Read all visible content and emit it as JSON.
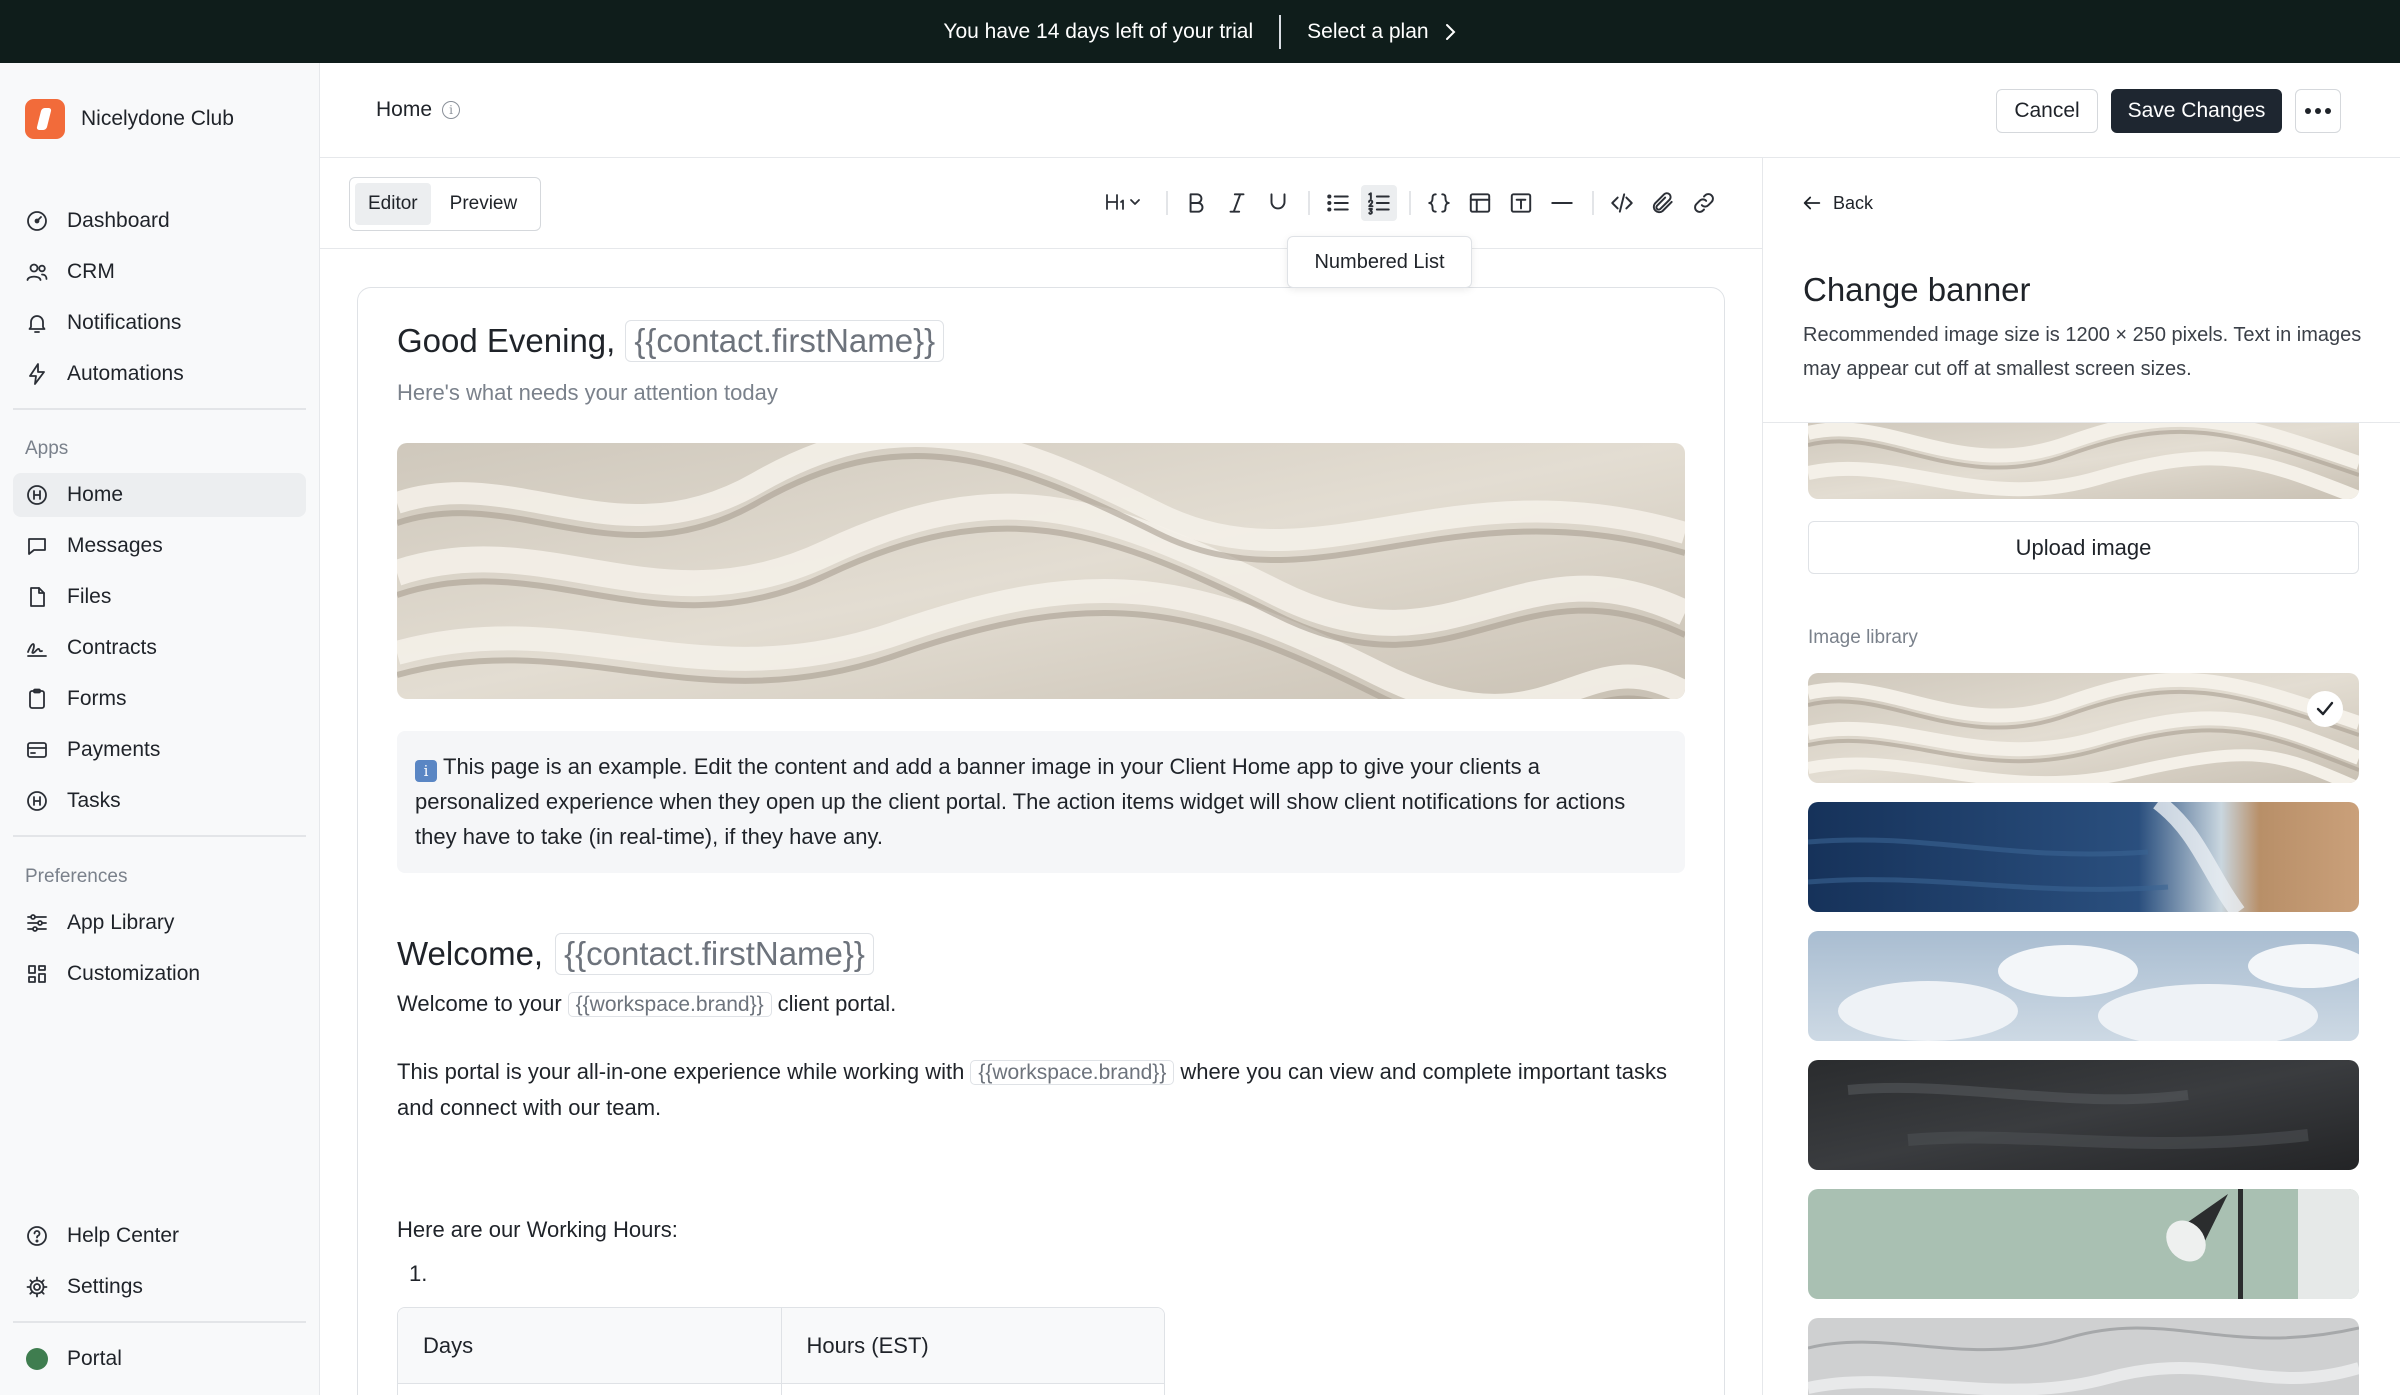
{
  "trial": {
    "message": "You have 14 days left of your trial",
    "cta": "Select a plan"
  },
  "brand": {
    "name": "Nicelydone Club",
    "accent": "#f26b3a"
  },
  "sidebar": {
    "main": [
      {
        "label": "Dashboard",
        "icon": "dashboard-icon"
      },
      {
        "label": "CRM",
        "icon": "users-icon"
      },
      {
        "label": "Notifications",
        "icon": "bell-icon"
      },
      {
        "label": "Automations",
        "icon": "bolt-icon"
      }
    ],
    "apps_title": "Apps",
    "apps": [
      {
        "label": "Home",
        "icon": "home-icon",
        "active": true
      },
      {
        "label": "Messages",
        "icon": "message-icon"
      },
      {
        "label": "Files",
        "icon": "file-icon"
      },
      {
        "label": "Contracts",
        "icon": "signature-icon"
      },
      {
        "label": "Forms",
        "icon": "clipboard-icon"
      },
      {
        "label": "Payments",
        "icon": "card-icon"
      },
      {
        "label": "Tasks",
        "icon": "tasks-icon"
      }
    ],
    "prefs_title": "Preferences",
    "prefs": [
      {
        "label": "App Library",
        "icon": "sliders-icon"
      },
      {
        "label": "Customization",
        "icon": "grid-icon"
      }
    ],
    "bottom": [
      {
        "label": "Help Center",
        "icon": "help-icon"
      },
      {
        "label": "Settings",
        "icon": "gear-icon"
      }
    ],
    "portal": {
      "label": "Portal",
      "color": "#3f7d4f"
    }
  },
  "topbar": {
    "title": "Home",
    "cancel": "Cancel",
    "save": "Save Changes"
  },
  "editor": {
    "tabs": [
      "Editor",
      "Preview"
    ],
    "active_tab": "Editor",
    "tooltip": "Numbered List",
    "heading_tool": "H1"
  },
  "content": {
    "greeting": "Good Evening,",
    "greeting_var": "{{contact.firstName}}",
    "subtitle": "Here's what needs your attention today",
    "note_icon": "i",
    "note": "This page is an example. Edit the content and add a banner image in your Client Home app to give your clients a personalized experience when they open up the client portal. The action items widget will show client notifications for actions they have to take (in real-time), if they have any.",
    "welcome": "Welcome,",
    "welcome_var": "{{contact.firstName}}",
    "welcome_line_pre": "Welcome to your",
    "welcome_line_var": "{{workspace.brand}}",
    "welcome_line_post": "client portal.",
    "portal_line_pre": "This portal is your all-in-one experience while working with",
    "portal_line_var": "{{workspace.brand}}",
    "portal_line_post": "where you can view and complete important tasks and connect with our team.",
    "hours_title": "Here are our Working Hours:",
    "list_marker": "1.",
    "table_headers": [
      "Days",
      "Hours (EST)"
    ]
  },
  "panel": {
    "back": "Back",
    "title": "Change banner",
    "description": "Recommended image size is 1200 × 250 pixels. Text in images may appear cut off at smallest screen sizes.",
    "upload": "Upload image",
    "library_label": "Image library",
    "library": [
      {
        "name": "sand-dunes",
        "selected": true
      },
      {
        "name": "ocean-waves",
        "selected": false
      },
      {
        "name": "clouds",
        "selected": false
      },
      {
        "name": "chalkboard",
        "selected": false
      },
      {
        "name": "lamp-wall",
        "selected": false
      },
      {
        "name": "marble",
        "selected": false
      }
    ]
  }
}
